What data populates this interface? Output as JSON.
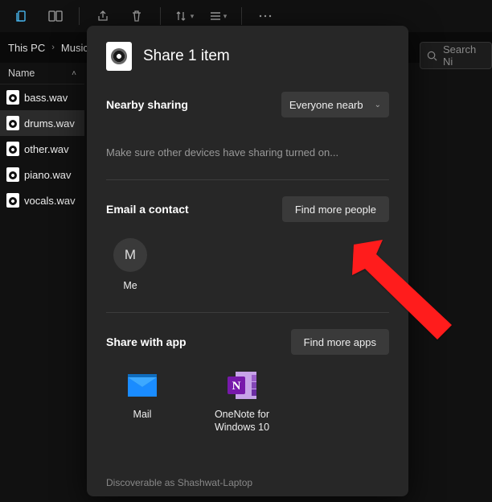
{
  "toolbar": {
    "buttons": [
      "copy-panel",
      "new-window",
      "share",
      "delete",
      "sort",
      "view",
      "more"
    ]
  },
  "breadcrumb": {
    "root": "This PC",
    "folder": "Music"
  },
  "search": {
    "placeholder": "Search Ni"
  },
  "list": {
    "header": "Name",
    "files": [
      {
        "name": "bass.wav",
        "selected": false
      },
      {
        "name": "drums.wav",
        "selected": true
      },
      {
        "name": "other.wav",
        "selected": false
      },
      {
        "name": "piano.wav",
        "selected": false
      },
      {
        "name": "vocals.wav",
        "selected": false
      }
    ]
  },
  "share": {
    "title": "Share 1 item",
    "nearby": {
      "label": "Nearby sharing",
      "selected": "Everyone nearb",
      "hint": "Make sure other devices have sharing turned on..."
    },
    "email": {
      "label": "Email a contact",
      "find_button": "Find more people",
      "contacts": [
        {
          "initial": "M",
          "label": "Me"
        }
      ]
    },
    "apps": {
      "label": "Share with app",
      "find_button": "Find more apps",
      "items": [
        {
          "id": "mail",
          "label": "Mail"
        },
        {
          "id": "onenote",
          "label": "OneNote for Windows 10"
        }
      ]
    },
    "discoverable": "Discoverable as Shashwat-Laptop"
  }
}
